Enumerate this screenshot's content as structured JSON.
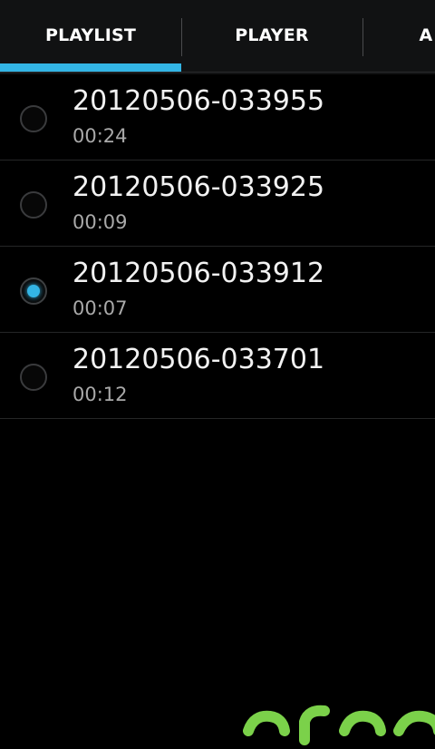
{
  "tabs": [
    {
      "label": "PLAYLIST",
      "selected": true
    },
    {
      "label": "PLAYER",
      "selected": false
    },
    {
      "label": "A",
      "selected": false
    }
  ],
  "recordings": [
    {
      "name": "20120506-033955",
      "duration": "00:24",
      "selected": false
    },
    {
      "name": "20120506-033925",
      "duration": "00:09",
      "selected": false
    },
    {
      "name": "20120506-033912",
      "duration": "00:07",
      "selected": true
    },
    {
      "name": "20120506-033701",
      "duration": "00:12",
      "selected": false
    }
  ],
  "colors": {
    "accent": "#33b5e5",
    "background": "#000000",
    "tabbar": "#111213",
    "watermark": "#7bd14a"
  },
  "icons": {
    "radio_unchecked": "radio-unchecked-icon",
    "radio_checked": "radio-checked-icon"
  }
}
